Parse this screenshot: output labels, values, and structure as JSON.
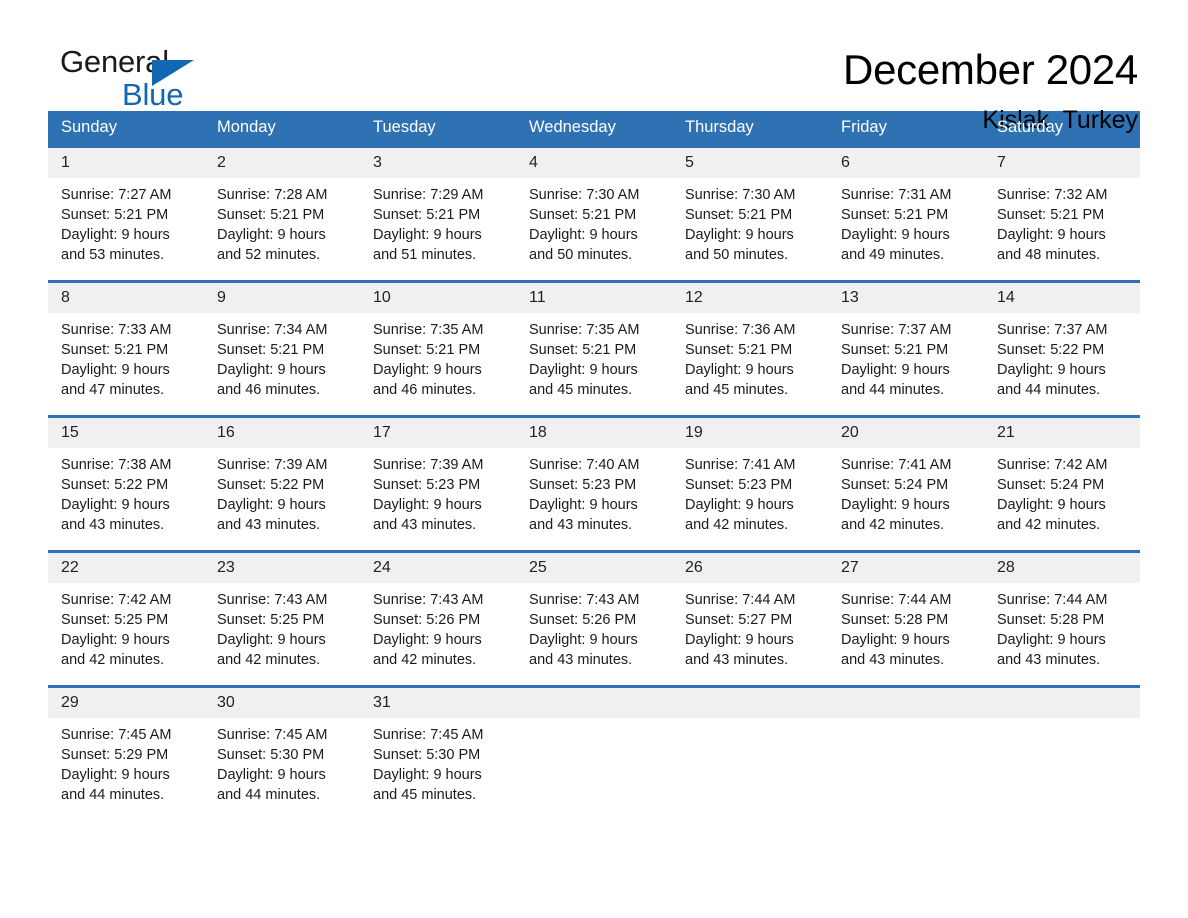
{
  "brand": {
    "name_part1": "General",
    "name_part2": "Blue",
    "accent_color": "#1267b2"
  },
  "header": {
    "month_title": "December 2024",
    "location": "Kislak, Turkey"
  },
  "calendar": {
    "header_color": "#2f72b4",
    "weekday_headers": [
      "Sunday",
      "Monday",
      "Tuesday",
      "Wednesday",
      "Thursday",
      "Friday",
      "Saturday"
    ],
    "weeks": [
      [
        {
          "day": "1",
          "sunrise": "Sunrise: 7:27 AM",
          "sunset": "Sunset: 5:21 PM",
          "daylight_line1": "Daylight: 9 hours",
          "daylight_line2": "and 53 minutes."
        },
        {
          "day": "2",
          "sunrise": "Sunrise: 7:28 AM",
          "sunset": "Sunset: 5:21 PM",
          "daylight_line1": "Daylight: 9 hours",
          "daylight_line2": "and 52 minutes."
        },
        {
          "day": "3",
          "sunrise": "Sunrise: 7:29 AM",
          "sunset": "Sunset: 5:21 PM",
          "daylight_line1": "Daylight: 9 hours",
          "daylight_line2": "and 51 minutes."
        },
        {
          "day": "4",
          "sunrise": "Sunrise: 7:30 AM",
          "sunset": "Sunset: 5:21 PM",
          "daylight_line1": "Daylight: 9 hours",
          "daylight_line2": "and 50 minutes."
        },
        {
          "day": "5",
          "sunrise": "Sunrise: 7:30 AM",
          "sunset": "Sunset: 5:21 PM",
          "daylight_line1": "Daylight: 9 hours",
          "daylight_line2": "and 50 minutes."
        },
        {
          "day": "6",
          "sunrise": "Sunrise: 7:31 AM",
          "sunset": "Sunset: 5:21 PM",
          "daylight_line1": "Daylight: 9 hours",
          "daylight_line2": "and 49 minutes."
        },
        {
          "day": "7",
          "sunrise": "Sunrise: 7:32 AM",
          "sunset": "Sunset: 5:21 PM",
          "daylight_line1": "Daylight: 9 hours",
          "daylight_line2": "and 48 minutes."
        }
      ],
      [
        {
          "day": "8",
          "sunrise": "Sunrise: 7:33 AM",
          "sunset": "Sunset: 5:21 PM",
          "daylight_line1": "Daylight: 9 hours",
          "daylight_line2": "and 47 minutes."
        },
        {
          "day": "9",
          "sunrise": "Sunrise: 7:34 AM",
          "sunset": "Sunset: 5:21 PM",
          "daylight_line1": "Daylight: 9 hours",
          "daylight_line2": "and 46 minutes."
        },
        {
          "day": "10",
          "sunrise": "Sunrise: 7:35 AM",
          "sunset": "Sunset: 5:21 PM",
          "daylight_line1": "Daylight: 9 hours",
          "daylight_line2": "and 46 minutes."
        },
        {
          "day": "11",
          "sunrise": "Sunrise: 7:35 AM",
          "sunset": "Sunset: 5:21 PM",
          "daylight_line1": "Daylight: 9 hours",
          "daylight_line2": "and 45 minutes."
        },
        {
          "day": "12",
          "sunrise": "Sunrise: 7:36 AM",
          "sunset": "Sunset: 5:21 PM",
          "daylight_line1": "Daylight: 9 hours",
          "daylight_line2": "and 45 minutes."
        },
        {
          "day": "13",
          "sunrise": "Sunrise: 7:37 AM",
          "sunset": "Sunset: 5:21 PM",
          "daylight_line1": "Daylight: 9 hours",
          "daylight_line2": "and 44 minutes."
        },
        {
          "day": "14",
          "sunrise": "Sunrise: 7:37 AM",
          "sunset": "Sunset: 5:22 PM",
          "daylight_line1": "Daylight: 9 hours",
          "daylight_line2": "and 44 minutes."
        }
      ],
      [
        {
          "day": "15",
          "sunrise": "Sunrise: 7:38 AM",
          "sunset": "Sunset: 5:22 PM",
          "daylight_line1": "Daylight: 9 hours",
          "daylight_line2": "and 43 minutes."
        },
        {
          "day": "16",
          "sunrise": "Sunrise: 7:39 AM",
          "sunset": "Sunset: 5:22 PM",
          "daylight_line1": "Daylight: 9 hours",
          "daylight_line2": "and 43 minutes."
        },
        {
          "day": "17",
          "sunrise": "Sunrise: 7:39 AM",
          "sunset": "Sunset: 5:23 PM",
          "daylight_line1": "Daylight: 9 hours",
          "daylight_line2": "and 43 minutes."
        },
        {
          "day": "18",
          "sunrise": "Sunrise: 7:40 AM",
          "sunset": "Sunset: 5:23 PM",
          "daylight_line1": "Daylight: 9 hours",
          "daylight_line2": "and 43 minutes."
        },
        {
          "day": "19",
          "sunrise": "Sunrise: 7:41 AM",
          "sunset": "Sunset: 5:23 PM",
          "daylight_line1": "Daylight: 9 hours",
          "daylight_line2": "and 42 minutes."
        },
        {
          "day": "20",
          "sunrise": "Sunrise: 7:41 AM",
          "sunset": "Sunset: 5:24 PM",
          "daylight_line1": "Daylight: 9 hours",
          "daylight_line2": "and 42 minutes."
        },
        {
          "day": "21",
          "sunrise": "Sunrise: 7:42 AM",
          "sunset": "Sunset: 5:24 PM",
          "daylight_line1": "Daylight: 9 hours",
          "daylight_line2": "and 42 minutes."
        }
      ],
      [
        {
          "day": "22",
          "sunrise": "Sunrise: 7:42 AM",
          "sunset": "Sunset: 5:25 PM",
          "daylight_line1": "Daylight: 9 hours",
          "daylight_line2": "and 42 minutes."
        },
        {
          "day": "23",
          "sunrise": "Sunrise: 7:43 AM",
          "sunset": "Sunset: 5:25 PM",
          "daylight_line1": "Daylight: 9 hours",
          "daylight_line2": "and 42 minutes."
        },
        {
          "day": "24",
          "sunrise": "Sunrise: 7:43 AM",
          "sunset": "Sunset: 5:26 PM",
          "daylight_line1": "Daylight: 9 hours",
          "daylight_line2": "and 42 minutes."
        },
        {
          "day": "25",
          "sunrise": "Sunrise: 7:43 AM",
          "sunset": "Sunset: 5:26 PM",
          "daylight_line1": "Daylight: 9 hours",
          "daylight_line2": "and 43 minutes."
        },
        {
          "day": "26",
          "sunrise": "Sunrise: 7:44 AM",
          "sunset": "Sunset: 5:27 PM",
          "daylight_line1": "Daylight: 9 hours",
          "daylight_line2": "and 43 minutes."
        },
        {
          "day": "27",
          "sunrise": "Sunrise: 7:44 AM",
          "sunset": "Sunset: 5:28 PM",
          "daylight_line1": "Daylight: 9 hours",
          "daylight_line2": "and 43 minutes."
        },
        {
          "day": "28",
          "sunrise": "Sunrise: 7:44 AM",
          "sunset": "Sunset: 5:28 PM",
          "daylight_line1": "Daylight: 9 hours",
          "daylight_line2": "and 43 minutes."
        }
      ],
      [
        {
          "day": "29",
          "sunrise": "Sunrise: 7:45 AM",
          "sunset": "Sunset: 5:29 PM",
          "daylight_line1": "Daylight: 9 hours",
          "daylight_line2": "and 44 minutes."
        },
        {
          "day": "30",
          "sunrise": "Sunrise: 7:45 AM",
          "sunset": "Sunset: 5:30 PM",
          "daylight_line1": "Daylight: 9 hours",
          "daylight_line2": "and 44 minutes."
        },
        {
          "day": "31",
          "sunrise": "Sunrise: 7:45 AM",
          "sunset": "Sunset: 5:30 PM",
          "daylight_line1": "Daylight: 9 hours",
          "daylight_line2": "and 45 minutes."
        },
        {
          "day": "",
          "sunrise": "",
          "sunset": "",
          "daylight_line1": "",
          "daylight_line2": ""
        },
        {
          "day": "",
          "sunrise": "",
          "sunset": "",
          "daylight_line1": "",
          "daylight_line2": ""
        },
        {
          "day": "",
          "sunrise": "",
          "sunset": "",
          "daylight_line1": "",
          "daylight_line2": ""
        },
        {
          "day": "",
          "sunrise": "",
          "sunset": "",
          "daylight_line1": "",
          "daylight_line2": ""
        }
      ]
    ]
  }
}
